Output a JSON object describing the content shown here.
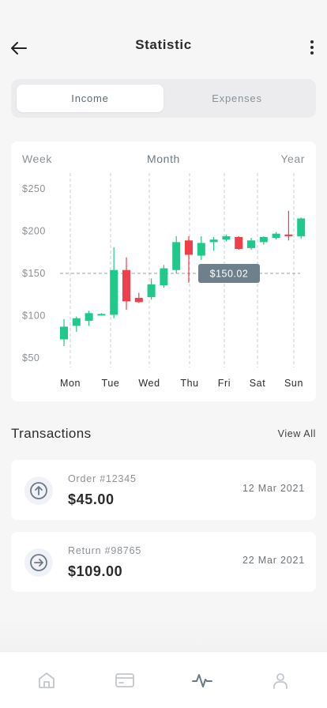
{
  "header": {
    "title": "Statistic",
    "back_icon": "arrow-left-icon",
    "more_icon": "more-vertical-icon"
  },
  "toggle": {
    "income_label": "Income",
    "expenses_label": "Expenses",
    "active": "Income"
  },
  "periods": {
    "week": "Week",
    "month": "Month",
    "year": "Year",
    "active": "Month"
  },
  "chart_data": {
    "type": "candlestick",
    "y_ticks": [
      "$250",
      "$200",
      "$150",
      "$100",
      "$50"
    ],
    "ylim": [
      50,
      250
    ],
    "x_labels": [
      "Mon",
      "Tue",
      "Wed",
      "Thu",
      "Fri",
      "Sat",
      "Sun"
    ],
    "reference_line": {
      "value": 150.02,
      "label": "$150.02"
    },
    "colors": {
      "up": "#1ec98a",
      "down": "#ef3f4b",
      "grid": "#c9cdd1",
      "tooltip": "#6e808c"
    },
    "candles": [
      {
        "open": 72,
        "close": 87,
        "high": 96,
        "low": 64,
        "dir": "up"
      },
      {
        "open": 88,
        "close": 97,
        "high": 99,
        "low": 81,
        "dir": "up"
      },
      {
        "open": 94,
        "close": 103,
        "high": 106,
        "low": 88,
        "dir": "up"
      },
      {
        "open": 101,
        "close": 102,
        "high": 103,
        "low": 100,
        "dir": "up"
      },
      {
        "open": 101,
        "close": 154,
        "high": 181,
        "low": 97,
        "dir": "up"
      },
      {
        "open": 154,
        "close": 117,
        "high": 169,
        "low": 107,
        "dir": "down"
      },
      {
        "open": 121,
        "close": 116,
        "high": 127,
        "low": 115,
        "dir": "down"
      },
      {
        "open": 122,
        "close": 137,
        "high": 144,
        "low": 119,
        "dir": "up"
      },
      {
        "open": 136,
        "close": 156,
        "high": 160,
        "low": 133,
        "dir": "up"
      },
      {
        "open": 154,
        "close": 187,
        "high": 194,
        "low": 150,
        "dir": "up"
      },
      {
        "open": 189,
        "close": 172,
        "high": 194,
        "low": 139,
        "dir": "down"
      },
      {
        "open": 171,
        "close": 186,
        "high": 194,
        "low": 166,
        "dir": "up"
      },
      {
        "open": 187,
        "close": 190,
        "high": 193,
        "low": 177,
        "dir": "up"
      },
      {
        "open": 190,
        "close": 194,
        "high": 196,
        "low": 188,
        "dir": "up"
      },
      {
        "open": 193,
        "close": 179,
        "high": 194,
        "low": 178,
        "dir": "down"
      },
      {
        "open": 180,
        "close": 189,
        "high": 192,
        "low": 178,
        "dir": "up"
      },
      {
        "open": 187,
        "close": 193,
        "high": 194,
        "low": 184,
        "dir": "up"
      },
      {
        "open": 192,
        "close": 197,
        "high": 199,
        "low": 190,
        "dir": "up"
      },
      {
        "open": 196,
        "close": 194,
        "high": 224,
        "low": 189,
        "dir": "down"
      },
      {
        "open": 194,
        "close": 215,
        "high": 216,
        "low": 191,
        "dir": "up"
      }
    ]
  },
  "transactions": {
    "title": "Transactions",
    "view_all": "View All",
    "items": [
      {
        "label": "Order #12345",
        "amount": "$45.00",
        "date": "12 Mar 2021",
        "icon": "arrow-up-circle-icon"
      },
      {
        "label": "Return #98765",
        "amount": "$109.00",
        "date": "22 Mar 2021",
        "icon": "arrow-right-circle-icon"
      }
    ]
  },
  "bottom_nav": {
    "items": [
      {
        "name": "home",
        "icon": "home-icon"
      },
      {
        "name": "wallet",
        "icon": "wallet-icon"
      },
      {
        "name": "statistic",
        "icon": "activity-icon",
        "active": true
      },
      {
        "name": "profile",
        "icon": "user-icon"
      }
    ]
  }
}
